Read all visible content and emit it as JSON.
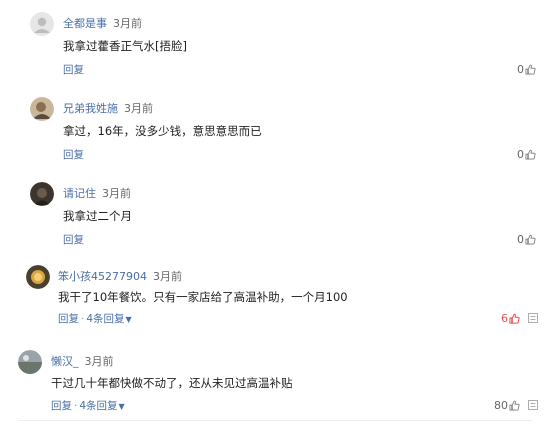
{
  "comments": [
    {
      "username": "全都是事",
      "time": "3月前",
      "text": "我拿过藿香正气水[捂脸]",
      "reply_label": "回复",
      "likes": "0",
      "avatar": "default-gray"
    },
    {
      "username": "兄弟我姓施",
      "time": "3月前",
      "text": "拿过，16年，没多少钱，意思意思而已",
      "reply_label": "回复",
      "likes": "0",
      "avatar": "photo-warm"
    },
    {
      "username": "请记住",
      "time": "3月前",
      "text": "我拿过二个月",
      "reply_label": "回复",
      "likes": "0",
      "avatar": "photo-dark"
    },
    {
      "username": "笨小孩45277904",
      "time": "3月前",
      "text": "我干了10年餐饮。只有一家店给了高温补助，一个月100",
      "reply_label": "回复",
      "replies_label": "4条回复",
      "likes": "6",
      "liked": true,
      "avatar": "photo-coin"
    },
    {
      "username": "懒汉_",
      "time": "3月前",
      "text": "干过几十年都快做不动了，还从未见过高温补贴",
      "reply_label": "回复",
      "replies_label": "4条回复",
      "likes": "80",
      "avatar": "photo-scene"
    }
  ],
  "icons": {
    "like": "thumbs-up-icon",
    "more": "more-icon",
    "expand": "chevron-down-icon"
  },
  "colors": {
    "link": "#4a6fa5",
    "liked": "#e34f4f"
  }
}
